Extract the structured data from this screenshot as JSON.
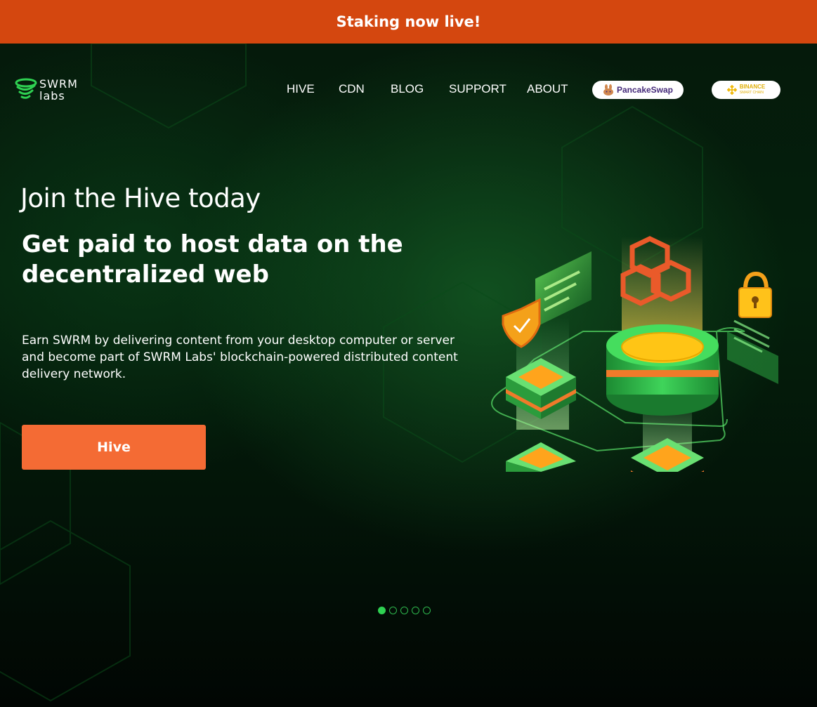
{
  "banner": {
    "text": "Staking now live!"
  },
  "logo": {
    "line1": "SWRM",
    "line2": "labs"
  },
  "nav": {
    "items": [
      {
        "label": "HIVE"
      },
      {
        "label": "CDN"
      },
      {
        "label": "BLOG"
      },
      {
        "label": "SUPPORT"
      },
      {
        "label": "ABOUT"
      }
    ],
    "pancakeswap": "PancakeSwap",
    "binance": {
      "line1": "BINANCE",
      "line2": "SMART CHAIN"
    }
  },
  "hero": {
    "kicker": "Join the Hive today",
    "headline": "Get paid to host data on the decentralized web",
    "body": "Earn SWRM by delivering content from your desktop computer or server and become part of SWRM Labs' blockchain-powered distributed content delivery network.",
    "cta": "Hive"
  },
  "carousel": {
    "total": 5,
    "active": 1
  },
  "colors": {
    "banner": "#d4470f",
    "cta": "#f46b34",
    "accent_green": "#2fd152",
    "background": "#04200c"
  },
  "icons": [
    "swrm-logo-icon",
    "pancake-bunny-icon",
    "binance-icon",
    "shield-check-icon",
    "lock-icon",
    "chain-link-icon"
  ]
}
